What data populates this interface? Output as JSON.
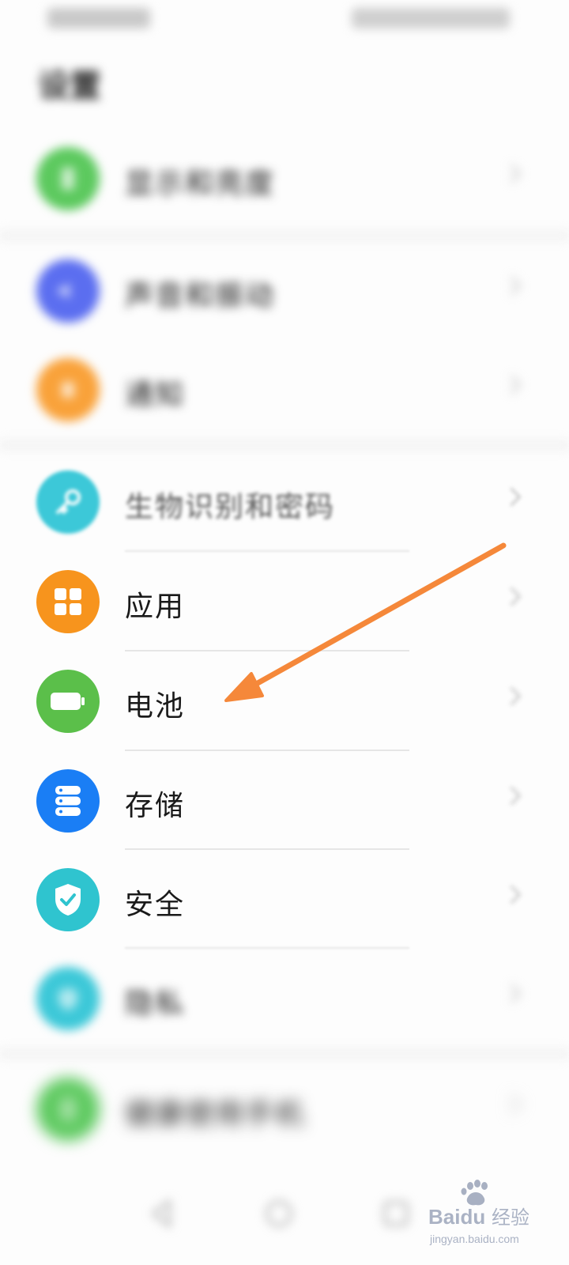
{
  "status_bar": {
    "left": "",
    "right": ""
  },
  "header": {
    "title": "设置"
  },
  "settings": {
    "items": [
      {
        "label": "显示和亮度",
        "icon": "display-icon",
        "color": "#5cc95e"
      },
      {
        "label": "声音和振动",
        "icon": "sound-icon",
        "color": "#5b6ef0"
      },
      {
        "label": "通知",
        "icon": "notification-icon",
        "color": "#f9a23a"
      },
      {
        "label": "生物识别和密码",
        "icon": "key-icon",
        "color": "#3cc8d8"
      },
      {
        "label": "应用",
        "icon": "apps-icon",
        "color": "#f7941d"
      },
      {
        "label": "电池",
        "icon": "battery-icon",
        "color": "#5bbf4a"
      },
      {
        "label": "存储",
        "icon": "storage-icon",
        "color": "#1a7ef5"
      },
      {
        "label": "安全",
        "icon": "shield-check-icon",
        "color": "#2fc4cf"
      },
      {
        "label": "隐私",
        "icon": "privacy-icon",
        "color": "#3cc8d8"
      },
      {
        "label": "健康使用手机",
        "icon": "health-icon",
        "color": "#5cc95e"
      }
    ]
  },
  "watermark": {
    "brand": "Baidu",
    "brand_cn": "经验",
    "url": "jingyan.baidu.com"
  },
  "annotation": {
    "arrow_color": "#f5883a"
  }
}
